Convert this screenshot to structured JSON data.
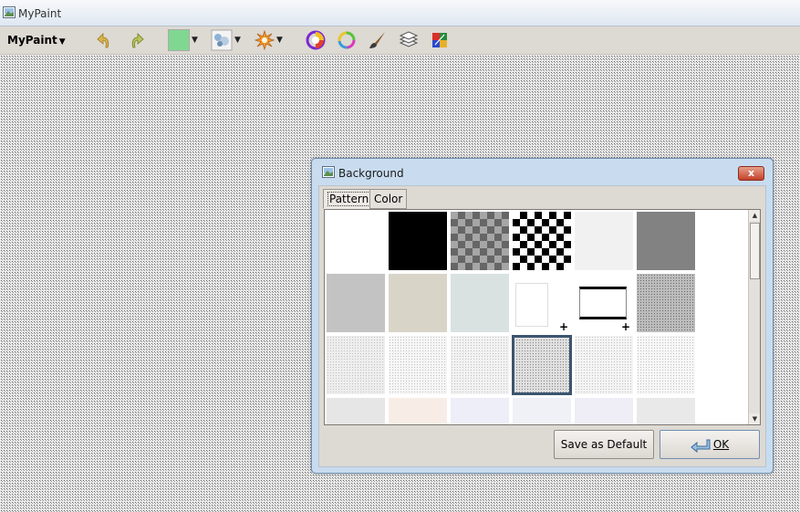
{
  "window": {
    "title": "MyPaint"
  },
  "toolbar": {
    "menu_label": "MyPaint",
    "color_swatch": "#80d890",
    "tools": [
      "undo-icon",
      "redo-icon",
      "color-swatch",
      "brush-picker-icon",
      "settings-icon",
      "color-wheel-icon",
      "color-ring-icon",
      "brush-icon",
      "layers-icon",
      "palette-icon"
    ]
  },
  "dialog": {
    "title": "Background",
    "close_label": "x",
    "tabs": [
      {
        "label": "Pattern",
        "active": true
      },
      {
        "label": "Color",
        "active": false
      }
    ],
    "tiles": [
      {
        "kind": "solid",
        "color": "#ffffff"
      },
      {
        "kind": "solid",
        "color": "#000000"
      },
      {
        "kind": "checker-small",
        "color": "#8a8a8a"
      },
      {
        "kind": "checker-large",
        "color": "#000000"
      },
      {
        "kind": "solid",
        "color": "#f1f1f1"
      },
      {
        "kind": "solid",
        "color": "#828282"
      },
      {
        "kind": "solid",
        "color": "#c3c3c3"
      },
      {
        "kind": "solid",
        "color": "#d8d5c8"
      },
      {
        "kind": "solid",
        "color": "#d9e1e1"
      },
      {
        "kind": "add-white",
        "color": "#ffffff"
      },
      {
        "kind": "add-frame",
        "color": "#ffffff"
      },
      {
        "kind": "noise",
        "color": "#bdbdbd"
      },
      {
        "kind": "noise-light",
        "color": "#eeeeee"
      },
      {
        "kind": "noise-light",
        "color": "#f6f6f6"
      },
      {
        "kind": "noise-light",
        "color": "#f2f2f2"
      },
      {
        "kind": "noise-selected",
        "color": "#e0e0e0"
      },
      {
        "kind": "noise-light",
        "color": "#f4f4f4"
      },
      {
        "kind": "noise-light",
        "color": "#f7f7f7"
      },
      {
        "kind": "solid",
        "color": "#e6e6e6"
      },
      {
        "kind": "solid",
        "color": "#f8ede6"
      },
      {
        "kind": "solid",
        "color": "#eeeef8"
      },
      {
        "kind": "solid",
        "color": "#f0f0f7"
      },
      {
        "kind": "solid",
        "color": "#efedf6"
      },
      {
        "kind": "solid",
        "color": "#e9e9e9"
      }
    ],
    "selected_tile": 15,
    "buttons": {
      "save_default": "Save as Default",
      "ok": "OK"
    }
  }
}
